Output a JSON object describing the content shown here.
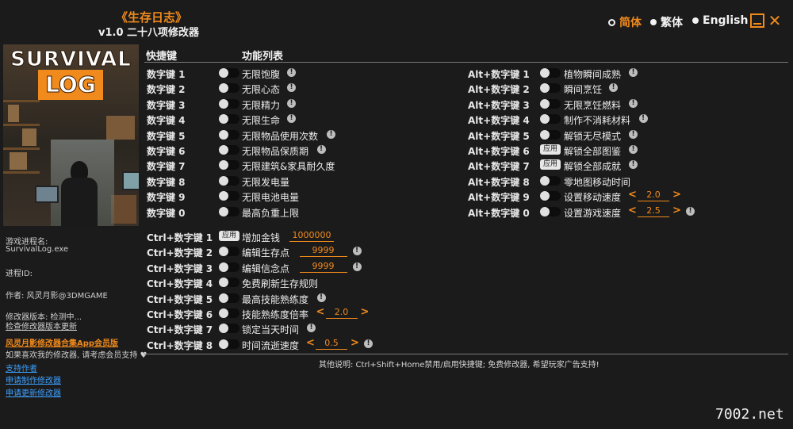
{
  "header": {
    "title": "《生存日志》",
    "subtitle": "v1.0 二十八项修改器",
    "languages": [
      "简体",
      "繁体",
      "English"
    ],
    "active_language": "简体"
  },
  "cover": {
    "line1": "SURVIVAL",
    "line2": "LOG"
  },
  "info": {
    "process_label": "游戏进程名:",
    "process_name": "SurvivalLog.exe",
    "pid_label": "进程ID:",
    "author": "作者: 风灵月影@3DMGAME",
    "version": "修改器版本: 检测中...",
    "check_update": "检查修改器版本更新",
    "member_link": "风灵月影修改器合集App会员版",
    "support_text": "如果喜欢我的修改器, 请考虑会员支持",
    "support_link": "支持作者",
    "request_link": "申请制作修改器",
    "update_request_link": "申请更新修改器"
  },
  "columns": {
    "hotkey": "快捷键",
    "features": "功能列表"
  },
  "left_features": [
    {
      "key": "数字键 1",
      "label": "无限饱腹",
      "warn": true
    },
    {
      "key": "数字键 2",
      "label": "无限心态",
      "warn": true
    },
    {
      "key": "数字键 3",
      "label": "无限精力",
      "warn": true
    },
    {
      "key": "数字键 4",
      "label": "无限生命",
      "warn": true
    },
    {
      "key": "数字键 5",
      "label": "无限物品使用次数",
      "warn": true
    },
    {
      "key": "数字键 6",
      "label": "无限物品保质期",
      "warn": true
    },
    {
      "key": "数字键 7",
      "label": "无限建筑&家具耐久度",
      "warn": false
    },
    {
      "key": "数字键 8",
      "label": "无限发电量",
      "warn": false
    },
    {
      "key": "数字键 9",
      "label": "无限电池电量",
      "warn": false
    },
    {
      "key": "数字键 0",
      "label": "最高负重上限",
      "warn": false
    }
  ],
  "right_features": [
    {
      "key": "Alt+数字键 1",
      "label": "植物瞬间成熟",
      "warn": true,
      "control": "toggle"
    },
    {
      "key": "Alt+数字键 2",
      "label": "瞬间烹饪",
      "warn": true,
      "control": "toggle"
    },
    {
      "key": "Alt+数字键 3",
      "label": "无限烹饪燃料",
      "warn": true,
      "control": "toggle"
    },
    {
      "key": "Alt+数字键 4",
      "label": "制作不消耗材料",
      "warn": true,
      "control": "toggle"
    },
    {
      "key": "Alt+数字键 5",
      "label": "解锁无尽模式",
      "warn": true,
      "control": "toggle"
    },
    {
      "key": "Alt+数字键 6",
      "label": "解锁全部图鉴",
      "warn": true,
      "control": "apply"
    },
    {
      "key": "Alt+数字键 7",
      "label": "解锁全部成就",
      "warn": true,
      "control": "apply"
    },
    {
      "key": "Alt+数字键 8",
      "label": "零地图移动时间",
      "warn": false,
      "control": "toggle"
    },
    {
      "key": "Alt+数字键 9",
      "label": "设置移动速度",
      "warn": false,
      "control": "toggle",
      "value": "2.0"
    },
    {
      "key": "Alt+数字键 0",
      "label": "设置游戏速度",
      "warn": true,
      "control": "toggle",
      "value": "2.5"
    }
  ],
  "ctrl_features": [
    {
      "key": "Ctrl+数字键 1",
      "label": "增加金钱",
      "control": "apply",
      "field": "1000000",
      "warn": false
    },
    {
      "key": "Ctrl+数字键 2",
      "label": "编辑生存点",
      "control": "toggle",
      "field": "9999",
      "warn": true
    },
    {
      "key": "Ctrl+数字键 3",
      "label": "编辑信念点",
      "control": "toggle",
      "field": "9999",
      "warn": true
    },
    {
      "key": "Ctrl+数字键 4",
      "label": "免费刷新生存规则",
      "control": "toggle",
      "warn": false
    },
    {
      "key": "Ctrl+数字键 5",
      "label": "最高技能熟练度",
      "control": "toggle",
      "warn": true
    },
    {
      "key": "Ctrl+数字键 6",
      "label": "技能熟练度倍率",
      "control": "toggle",
      "value": "2.0",
      "warn": false
    },
    {
      "key": "Ctrl+数字键 7",
      "label": "锁定当天时间",
      "control": "toggle",
      "warn": true
    },
    {
      "key": "Ctrl+数字键 8",
      "label": "时间流逝速度",
      "control": "toggle",
      "value": "0.5",
      "warn": true
    }
  ],
  "apply_label": "应用",
  "warn_glyph": "!",
  "arrow_left": "<",
  "arrow_right": ">",
  "footer_note": "其他说明: Ctrl+Shift+Home禁用/启用快捷键; 免费修改器, 希望玩家广告支持!",
  "watermark": "7002.net",
  "colors": {
    "accent": "#f08a1c",
    "background": "#1b1b1b",
    "link": "#3ea0ff"
  }
}
